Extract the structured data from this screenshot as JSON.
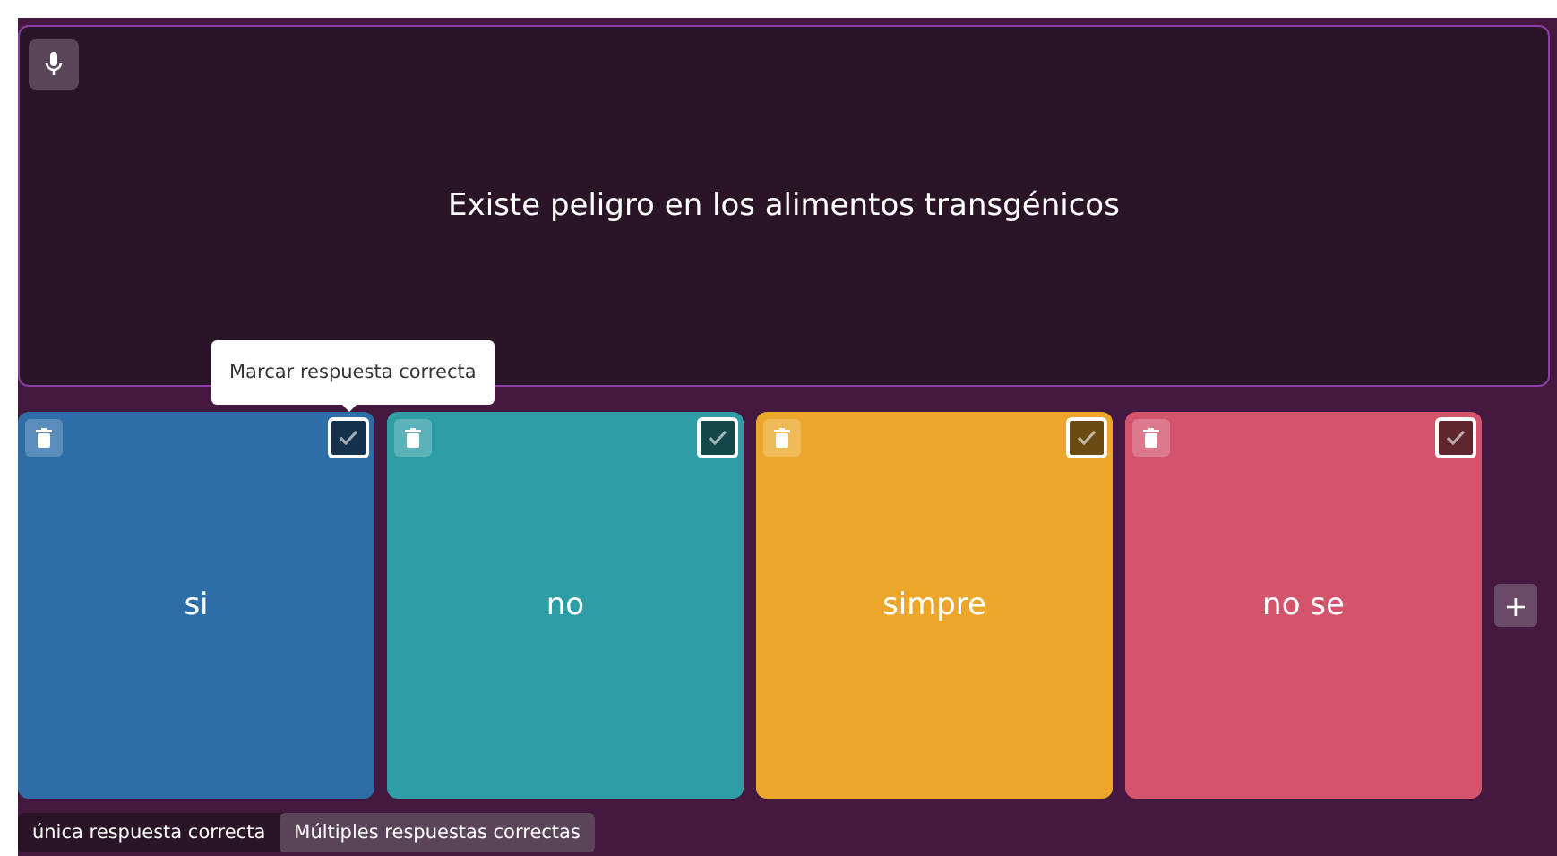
{
  "question": {
    "text": "Existe peligro en los alimentos transgénicos"
  },
  "tooltip": "Marcar respuesta correcta",
  "answers": [
    {
      "text": "si",
      "color": "#2d6ea8"
    },
    {
      "text": "no",
      "color": "#2e9da5"
    },
    {
      "text": "simpre",
      "color": "#eca72b"
    },
    {
      "text": "no se",
      "color": "#d3546c"
    }
  ],
  "add_button": "+",
  "modes": [
    {
      "label": "única respuesta correcta",
      "selected": false
    },
    {
      "label": "Múltiples respuestas correctas",
      "selected": true
    }
  ]
}
